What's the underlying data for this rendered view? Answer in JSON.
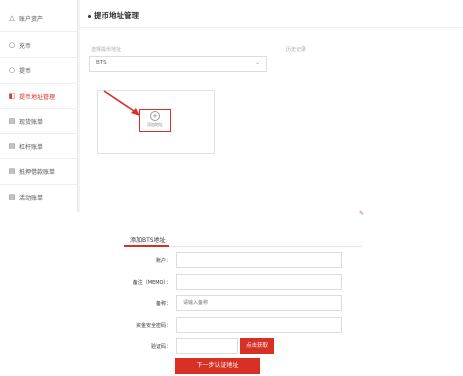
{
  "sidebar": {
    "items": [
      {
        "label": "账户资产",
        "icon": "bank-icon"
      },
      {
        "label": "充币",
        "icon": "coin-in-icon"
      },
      {
        "label": "提币",
        "icon": "coin-out-icon"
      },
      {
        "label": "提币地址管理",
        "icon": "address-icon",
        "active": true
      },
      {
        "label": "现货账单",
        "icon": "document-icon"
      },
      {
        "label": "杠杆账单",
        "icon": "document-icon"
      },
      {
        "label": "抵押借款账单",
        "icon": "document-icon"
      },
      {
        "label": "活动账单",
        "icon": "document-icon"
      }
    ]
  },
  "main": {
    "title": "提币地址管理",
    "currency_label": "选择提币地址",
    "record_label": "历史记录",
    "currency_value": "BTS",
    "add_address_label": "添加地址"
  },
  "form": {
    "tab_label": "添加BTS地址",
    "fields": [
      {
        "label": "账户：",
        "placeholder": ""
      },
      {
        "label": "备注（MEMO）：",
        "placeholder": ""
      },
      {
        "label": "备称：",
        "placeholder": "请输入备称"
      },
      {
        "label": "资金安全密码：",
        "placeholder": ""
      },
      {
        "label": "验证码：",
        "placeholder": ""
      }
    ],
    "get_code_label": "点击获取",
    "submit_label": "下一步认证地址"
  },
  "colors": {
    "accent": "#d93025"
  }
}
